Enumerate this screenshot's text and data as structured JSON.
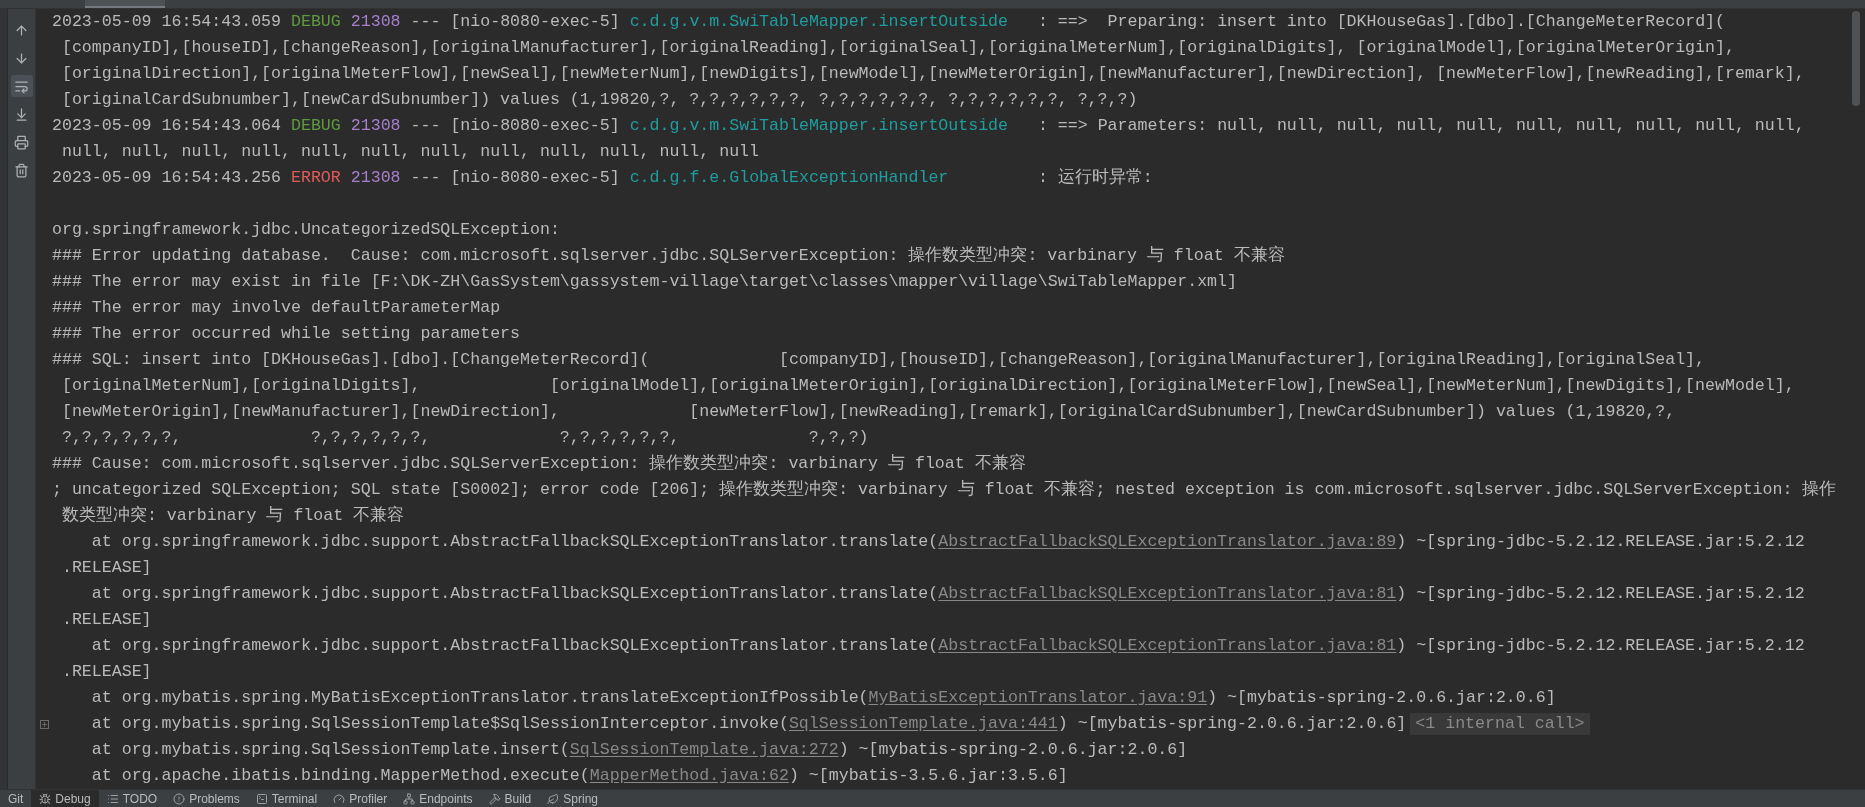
{
  "toolbar": [
    {
      "on": false
    },
    {
      "on": false
    },
    {
      "on": true
    },
    {
      "on": false
    },
    {
      "on": false
    },
    {
      "on": false
    }
  ],
  "console": {
    "lines": [
      {
        "kind": "log",
        "timestamp": "2023-05-09 16:54:43.059",
        "severity": "DEBUG",
        "color": "#5e9b3e",
        "pid": "21308",
        "separator": "---",
        "thread": "[nio-8080-exec-5]",
        "logger": "c.d.g.v.m.SwiTableMapper.insertOutside",
        "message": ": ==>  Preparing: insert into [DKHouseGas].[dbo].[ChangeMeterRecord]("
      },
      {
        "kind": "text",
        "text": " [companyID],[houseID],[changeReason],[originalManufacturer],[originalReading],[originalSeal],[originalMeterNum],[originalDigits], [originalModel],[originalMeterOrigin],"
      },
      {
        "kind": "text",
        "text": " [originalDirection],[originalMeterFlow],[newSeal],[newMeterNum],[newDigits],[newModel],[newMeterOrigin],[newManufacturer],[newDirection], [newMeterFlow],[newReading],[remark],"
      },
      {
        "kind": "text",
        "text": " [originalCardSubnumber],[newCardSubnumber]) values (1,19820,?, ?,?,?,?,?,?, ?,?,?,?,?,?, ?,?,?,?,?,?, ?,?,?)"
      },
      {
        "kind": "log",
        "timestamp": "2023-05-09 16:54:43.064",
        "severity": "DEBUG",
        "color": "#5e9b3e",
        "pid": "21308",
        "separator": "---",
        "thread": "[nio-8080-exec-5]",
        "logger": "c.d.g.v.m.SwiTableMapper.insertOutside",
        "message": ": ==> Parameters: null, null, null, null, null, null, null, null, null, null,"
      },
      {
        "kind": "text",
        "text": " null, null, null, null, null, null, null, null, null, null, null, null"
      },
      {
        "kind": "log",
        "timestamp": "2023-05-09 16:54:43.256",
        "severity": "ERROR",
        "color": "#e05a5a",
        "pid": "21308",
        "separator": "---",
        "thread": "[nio-8080-exec-5]",
        "logger": "c.d.g.f.e.GlobalExceptionHandler",
        "message": ": 运行时异常:"
      },
      {
        "kind": "blank"
      },
      {
        "kind": "text",
        "text": "org.springframework.jdbc.UncategorizedSQLException:"
      },
      {
        "kind": "text",
        "text": "### Error updating database.  Cause: com.microsoft.sqlserver.jdbc.SQLServerException: 操作数类型冲突: varbinary 与 float 不兼容"
      },
      {
        "kind": "text",
        "text": "### The error may exist in file [F:\\DK-ZH\\GasSystem\\gassystem-village\\target\\classes\\mapper\\village\\SwiTableMapper.xml]"
      },
      {
        "kind": "text",
        "text": "### The error may involve defaultParameterMap"
      },
      {
        "kind": "text",
        "text": "### The error occurred while setting parameters"
      },
      {
        "kind": "text",
        "text": "### SQL: insert into [DKHouseGas].[dbo].[ChangeMeterRecord](             [companyID],[houseID],[changeReason],[originalManufacturer],[originalReading],[originalSeal],"
      },
      {
        "kind": "text",
        "text": " [originalMeterNum],[originalDigits],             [originalModel],[originalMeterOrigin],[originalDirection],[originalMeterFlow],[newSeal],[newMeterNum],[newDigits],[newModel],"
      },
      {
        "kind": "text",
        "text": " [newMeterOrigin],[newManufacturer],[newDirection],             [newMeterFlow],[newReading],[remark],[originalCardSubnumber],[newCardSubnumber]) values (1,19820,?,"
      },
      {
        "kind": "text",
        "text": " ?,?,?,?,?,?,             ?,?,?,?,?,?,             ?,?,?,?,?,?,             ?,?,?)"
      },
      {
        "kind": "text",
        "text": "### Cause: com.microsoft.sqlserver.jdbc.SQLServerException: 操作数类型冲突: varbinary 与 float 不兼容"
      },
      {
        "kind": "text",
        "text": "; uncategorized SQLException; SQL state [S0002]; error code [206]; 操作数类型冲突: varbinary 与 float 不兼容; nested exception is com.microsoft.sqlserver.jdbc.SQLServerException: 操作"
      },
      {
        "kind": "text",
        "text": " 数类型冲突: varbinary 与 float 不兼容"
      },
      {
        "kind": "frame",
        "foldable": false,
        "text": "    at org.springframework.jdbc.support.AbstractFallbackSQLExceptionTranslator.translate(",
        "link": "AbstractFallbackSQLExceptionTranslator.java:89",
        "tail": ") ~[spring-jdbc-5.2.12.RELEASE.jar:5.2.12"
      },
      {
        "kind": "text",
        "text": " .RELEASE]"
      },
      {
        "kind": "frame",
        "foldable": false,
        "text": "    at org.springframework.jdbc.support.AbstractFallbackSQLExceptionTranslator.translate(",
        "link": "AbstractFallbackSQLExceptionTranslator.java:81",
        "tail": ") ~[spring-jdbc-5.2.12.RELEASE.jar:5.2.12"
      },
      {
        "kind": "text",
        "text": " .RELEASE]"
      },
      {
        "kind": "frame",
        "foldable": false,
        "text": "    at org.springframework.jdbc.support.AbstractFallbackSQLExceptionTranslator.translate(",
        "link": "AbstractFallbackSQLExceptionTranslator.java:81",
        "tail": ") ~[spring-jdbc-5.2.12.RELEASE.jar:5.2.12"
      },
      {
        "kind": "text",
        "text": " .RELEASE]"
      },
      {
        "kind": "frame",
        "foldable": false,
        "text": "    at org.mybatis.spring.MyBatisExceptionTranslator.translateExceptionIfPossible(",
        "link": "MyBatisExceptionTranslator.java:91",
        "tail": ") ~[mybatis-spring-2.0.6.jar:2.0.6]"
      },
      {
        "kind": "frame",
        "foldable": true,
        "text": "    at org.mybatis.spring.SqlSessionTemplate$SqlSessionInterceptor.invoke(",
        "link": "SqlSessionTemplate.java:441",
        "tail": ") ~[mybatis-spring-2.0.6.jar:2.0.6]",
        "hint": "<1 internal call>"
      },
      {
        "kind": "frame",
        "foldable": false,
        "text": "    at org.mybatis.spring.SqlSessionTemplate.insert(",
        "link": "SqlSessionTemplate.java:272",
        "tail": ") ~[mybatis-spring-2.0.6.jar:2.0.6]"
      },
      {
        "kind": "frame",
        "foldable": false,
        "text": "    at org.apache.ibatis.binding.MapperMethod.execute(",
        "link": "MapperMethod.java:62",
        "tail": ") ~[mybatis-3.5.6.jar:3.5.6]"
      }
    ]
  },
  "tool_tabs": [
    {
      "label": "Git",
      "selected": false
    },
    {
      "label": "Debug",
      "selected": true
    },
    {
      "label": "TODO",
      "selected": false
    },
    {
      "label": "Problems",
      "selected": false
    },
    {
      "label": "Terminal",
      "selected": false
    },
    {
      "label": "Profiler",
      "selected": false
    },
    {
      "label": "Endpoints",
      "selected": false
    },
    {
      "label": "Build",
      "selected": false
    },
    {
      "label": "Spring",
      "selected": false
    }
  ]
}
